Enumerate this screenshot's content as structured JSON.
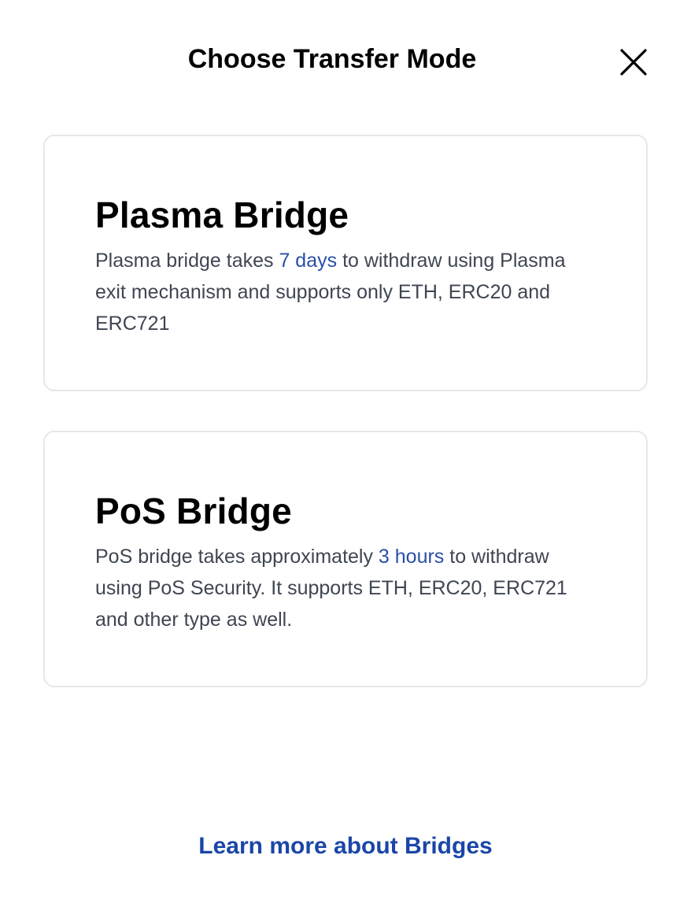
{
  "modal": {
    "title": "Choose Transfer Mode",
    "close_icon": "close-icon"
  },
  "cards": [
    {
      "title": "Plasma Bridge",
      "desc_before": "Plasma bridge takes ",
      "desc_highlight": "7 days",
      "desc_after": " to withdraw using Plasma exit mechanism and supports only ETH, ERC20 and ERC721"
    },
    {
      "title": "PoS Bridge",
      "desc_before": "PoS bridge takes approximately ",
      "desc_highlight": "3 hours",
      "desc_after": " to withdraw using PoS Security. It supports ETH, ERC20, ERC721 and other type as well."
    }
  ],
  "footer": {
    "learn_more_label": "Learn more about Bridges"
  },
  "colors": {
    "highlight": "#2a4fa8",
    "link": "#1b46a8",
    "card_border": "#e6e7eb",
    "body_text": "#3f4552"
  }
}
